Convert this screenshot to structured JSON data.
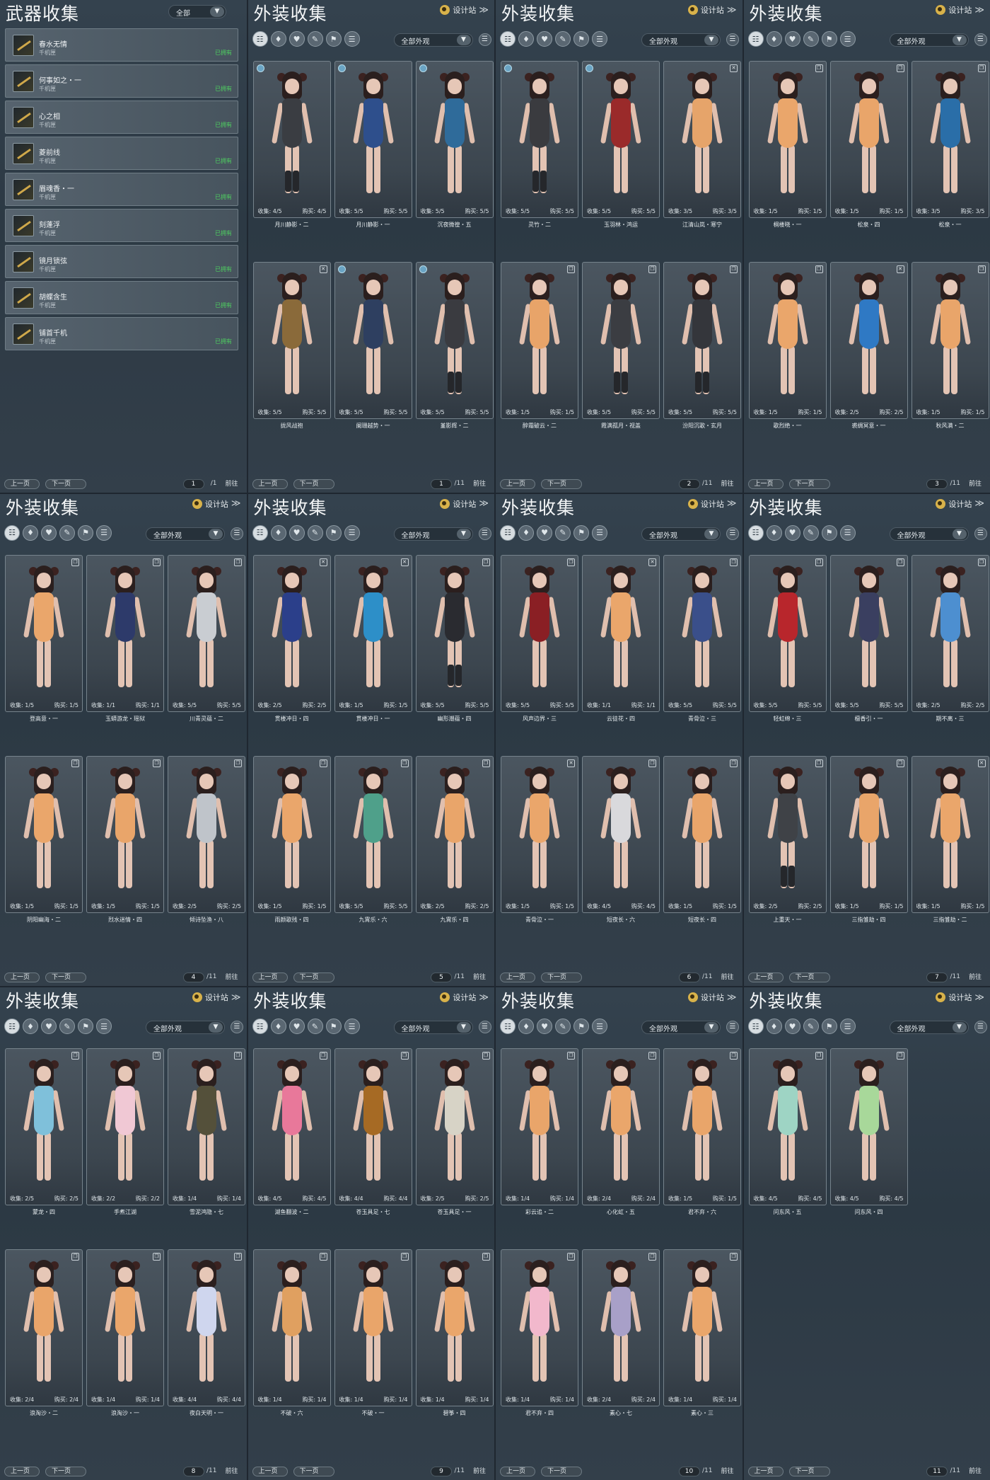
{
  "weapon_panel": {
    "title": "武器收集",
    "filter_value": "全部",
    "items": [
      {
        "name": "春水无情",
        "sub": "千机匣",
        "status": "已拥有"
      },
      {
        "name": "何事如之・一",
        "sub": "千机匣",
        "status": "已拥有"
      },
      {
        "name": "心之相",
        "sub": "千机匣",
        "status": "已拥有"
      },
      {
        "name": "菱前线",
        "sub": "千机匣",
        "status": "已拥有"
      },
      {
        "name": "眉魂香・一",
        "sub": "千机匣",
        "status": "已拥有"
      },
      {
        "name": "刻蓬浮",
        "sub": "千机匣",
        "status": "已拥有"
      },
      {
        "name": "镜月锁弦",
        "sub": "千机匣",
        "status": "已拥有"
      },
      {
        "name": "胡蝶含生",
        "sub": "千机匣",
        "status": "已拥有"
      },
      {
        "name": "铺首千机",
        "sub": "千机匣",
        "status": "已拥有"
      }
    ],
    "pager": {
      "prev": "上一页",
      "next": "下一页",
      "page": "1",
      "total": "/1",
      "go": "前往"
    }
  },
  "common": {
    "title": "外装收集",
    "design_label": "设计站",
    "chevron": "≫",
    "filter_value": "全部外观",
    "collect_label": "收集:",
    "buy_label": "购买:",
    "prev": "上一页",
    "next": "下一页",
    "go": "前往"
  },
  "outfit_panels": [
    {
      "page": "1",
      "total": "/11",
      "cards": [
        {
          "name": "月川静影・二",
          "collect": "4/5",
          "buy": "4/5",
          "tone": "#3a3d42",
          "badge": "blue"
        },
        {
          "name": "月川静影・一",
          "collect": "5/5",
          "buy": "5/5",
          "tone": "#2e4f8c",
          "badge": "blue"
        },
        {
          "name": "沉夜微徨・五",
          "collect": "5/5",
          "buy": "5/5",
          "tone": "#2f6b9a",
          "badge": "blue"
        },
        {
          "name": "拢风战袍",
          "collect": "5/5",
          "buy": "5/5",
          "tone": "#8a6a3a",
          "badge": "trash"
        },
        {
          "name": "阑珊越势・一",
          "collect": "5/5",
          "buy": "5/5",
          "tone": "#2e3f60",
          "badge": "blue"
        },
        {
          "name": "堇影辉・二",
          "collect": "5/5",
          "buy": "5/5",
          "tone": "#3a3b40",
          "badge": "blue"
        }
      ]
    },
    {
      "page": "2",
      "total": "/11",
      "cards": [
        {
          "name": "灵竹・二",
          "collect": "5/5",
          "buy": "5/5",
          "tone": "#3a3b3f",
          "badge": "blue"
        },
        {
          "name": "玉羽林・鸿运",
          "collect": "5/5",
          "buy": "5/5",
          "tone": "#9a2a2a",
          "badge": "blue"
        },
        {
          "name": "江清山岚・寒宁",
          "collect": "3/5",
          "buy": "3/5",
          "tone": "#e6a46a",
          "badge": "trash"
        },
        {
          "name": "醉霜破云・二",
          "collect": "1/5",
          "buy": "1/5",
          "tone": "#e8a469",
          "badge": "copy"
        },
        {
          "name": "霞满孤月・视盖",
          "collect": "5/5",
          "buy": "5/5",
          "tone": "#3b3d42",
          "badge": "copy"
        },
        {
          "name": "汾阳沉歌・玄月",
          "collect": "5/5",
          "buy": "5/5",
          "tone": "#34363b",
          "badge": "copy"
        }
      ]
    },
    {
      "page": "3",
      "total": "/11",
      "cards": [
        {
          "name": "桐楼晓・一",
          "collect": "1/5",
          "buy": "1/5",
          "tone": "#eaa66b",
          "badge": "copy"
        },
        {
          "name": "松泉・四",
          "collect": "1/5",
          "buy": "1/5",
          "tone": "#e9a56a",
          "badge": "copy"
        },
        {
          "name": "松泉・一",
          "collect": "3/5",
          "buy": "3/5",
          "tone": "#2a6ea8",
          "badge": "copy"
        },
        {
          "name": "歌烈绝・一",
          "collect": "1/5",
          "buy": "1/5",
          "tone": "#eaa66b",
          "badge": "copy"
        },
        {
          "name": "裘绸冥意・一",
          "collect": "2/5",
          "buy": "2/5",
          "tone": "#2f79c4",
          "badge": "trash"
        },
        {
          "name": "秋风满・二",
          "collect": "1/5",
          "buy": "1/5",
          "tone": "#e9a56a",
          "badge": "copy"
        }
      ]
    },
    {
      "page": "4",
      "total": "/11",
      "cards": [
        {
          "name": "登高意・一",
          "collect": "1/5",
          "buy": "1/5",
          "tone": "#eaa66b",
          "badge": "copy"
        },
        {
          "name": "玉蟒游龙・瑶狱",
          "collect": "1/1",
          "buy": "1/1",
          "tone": "#2d3a6a",
          "badge": "copy"
        },
        {
          "name": "川青灵蕴・二",
          "collect": "5/5",
          "buy": "5/5",
          "tone": "#c9cdd2",
          "badge": "copy"
        },
        {
          "name": "阴阳幽海・二",
          "collect": "1/5",
          "buy": "1/5",
          "tone": "#eaa66b",
          "badge": "copy"
        },
        {
          "name": "烈水迷情・四",
          "collect": "1/5",
          "buy": "1/5",
          "tone": "#e9a56a",
          "badge": "copy"
        },
        {
          "name": "倾诗坠渔・八",
          "collect": "2/5",
          "buy": "2/5",
          "tone": "#bfc4ca",
          "badge": "copy"
        }
      ]
    },
    {
      "page": "5",
      "total": "/11",
      "cards": [
        {
          "name": "贯楼冲日・四",
          "collect": "2/5",
          "buy": "2/5",
          "tone": "#2b3f8a",
          "badge": "trash"
        },
        {
          "name": "贯楼冲日・一",
          "collect": "1/5",
          "buy": "1/5",
          "tone": "#2d8fc8",
          "badge": "trash"
        },
        {
          "name": "幽形潮蕴・四",
          "collect": "5/5",
          "buy": "5/5",
          "tone": "#2a2b30",
          "badge": "copy"
        },
        {
          "name": "雨颜歌残・四",
          "collect": "1/5",
          "buy": "1/5",
          "tone": "#eaa66b",
          "badge": "copy"
        },
        {
          "name": "九霄乐・六",
          "collect": "5/5",
          "buy": "5/5",
          "tone": "#4fa08a",
          "badge": "copy"
        },
        {
          "name": "九霄乐・四",
          "collect": "2/5",
          "buy": "2/5",
          "tone": "#e9a56a",
          "badge": "copy"
        }
      ]
    },
    {
      "page": "6",
      "total": "/11",
      "cards": [
        {
          "name": "风声边界・三",
          "collect": "5/5",
          "buy": "5/5",
          "tone": "#8a1f24",
          "badge": "copy"
        },
        {
          "name": "云徒花・四",
          "collect": "1/1",
          "buy": "1/1",
          "tone": "#eaa66b",
          "badge": "trash"
        },
        {
          "name": "青骨泣・三",
          "collect": "5/5",
          "buy": "5/5",
          "tone": "#3a4f8a",
          "badge": "copy"
        },
        {
          "name": "青骨泣・一",
          "collect": "1/5",
          "buy": "1/5",
          "tone": "#eaa66b",
          "badge": "trash"
        },
        {
          "name": "短夜长・六",
          "collect": "4/5",
          "buy": "4/5",
          "tone": "#d9d9dc",
          "badge": "copy"
        },
        {
          "name": "短夜长・四",
          "collect": "1/5",
          "buy": "1/5",
          "tone": "#e9a56a",
          "badge": "copy"
        }
      ]
    },
    {
      "page": "7",
      "total": "/11",
      "cards": [
        {
          "name": "轻虹绵・三",
          "collect": "5/5",
          "buy": "5/5",
          "tone": "#b8262c",
          "badge": "copy"
        },
        {
          "name": "檀香引・一",
          "collect": "5/5",
          "buy": "5/5",
          "tone": "#3a3f60",
          "badge": "copy"
        },
        {
          "name": "期不离・三",
          "collect": "2/5",
          "buy": "2/5",
          "tone": "#4d8fd0",
          "badge": "copy"
        },
        {
          "name": "上重天・一",
          "collect": "2/5",
          "buy": "2/5",
          "tone": "#3f4247",
          "badge": "copy"
        },
        {
          "name": "三指雏劫・四",
          "collect": "1/5",
          "buy": "1/5",
          "tone": "#e9a56a",
          "badge": "copy"
        },
        {
          "name": "三指雏劫・二",
          "collect": "1/5",
          "buy": "1/5",
          "tone": "#eaa66b",
          "badge": "trash"
        }
      ]
    },
    {
      "page": "8",
      "total": "/11",
      "cards": [
        {
          "name": "蒙龙・四",
          "collect": "2/5",
          "buy": "2/5",
          "tone": "#7fc0da",
          "badge": "copy"
        },
        {
          "name": "手煮江湖",
          "collect": "2/2",
          "buy": "2/2",
          "tone": "#f0c8d4",
          "badge": "copy"
        },
        {
          "name": "雪泥鸿隐・七",
          "collect": "1/4",
          "buy": "1/4",
          "tone": "#54503a",
          "badge": "copy"
        },
        {
          "name": "浪淘沙・二",
          "collect": "2/4",
          "buy": "2/4",
          "tone": "#e9a56a",
          "badge": "copy"
        },
        {
          "name": "浪淘沙・一",
          "collect": "1/4",
          "buy": "1/4",
          "tone": "#eaa66b",
          "badge": "copy"
        },
        {
          "name": "夜白天明・一",
          "collect": "4/4",
          "buy": "4/4",
          "tone": "#cfd6ee",
          "badge": "copy"
        }
      ]
    },
    {
      "page": "9",
      "total": "/11",
      "cards": [
        {
          "name": "湖鱼翻波・二",
          "collect": "4/5",
          "buy": "4/5",
          "tone": "#e8789a",
          "badge": "copy"
        },
        {
          "name": "苍玉具足・七",
          "collect": "4/4",
          "buy": "4/4",
          "tone": "#a66a24",
          "badge": "copy"
        },
        {
          "name": "苍玉具足・一",
          "collect": "2/5",
          "buy": "2/5",
          "tone": "#d7d3c6",
          "badge": "copy"
        },
        {
          "name": "不破・六",
          "collect": "1/4",
          "buy": "1/4",
          "tone": "#e0a060",
          "badge": "copy"
        },
        {
          "name": "不破・一",
          "collect": "1/4",
          "buy": "1/4",
          "tone": "#e9a56a",
          "badge": "copy"
        },
        {
          "name": "碧筝・四",
          "collect": "1/4",
          "buy": "1/4",
          "tone": "#eaa66b",
          "badge": "copy"
        }
      ]
    },
    {
      "page": "10",
      "total": "/11",
      "cards": [
        {
          "name": "彩云追・二",
          "collect": "1/4",
          "buy": "1/4",
          "tone": "#e9a56a",
          "badge": "copy"
        },
        {
          "name": "心化虹・五",
          "collect": "2/4",
          "buy": "2/4",
          "tone": "#eaa66b",
          "badge": "copy"
        },
        {
          "name": "君不弃・六",
          "collect": "1/5",
          "buy": "1/5",
          "tone": "#e9a56a",
          "badge": "copy"
        },
        {
          "name": "君不弃・四",
          "collect": "1/4",
          "buy": "1/4",
          "tone": "#f2b8cc",
          "badge": "copy"
        },
        {
          "name": "素心・七",
          "collect": "2/4",
          "buy": "2/4",
          "tone": "#a8a0c8",
          "badge": "copy"
        },
        {
          "name": "素心・三",
          "collect": "1/4",
          "buy": "1/4",
          "tone": "#eaa66b",
          "badge": "copy"
        }
      ]
    },
    {
      "page": "11",
      "total": "/11",
      "cards": [
        {
          "name": "问东风・五",
          "collect": "4/5",
          "buy": "4/5",
          "tone": "#9ed4c4",
          "badge": "copy"
        },
        {
          "name": "问东风・四",
          "collect": "4/5",
          "buy": "4/5",
          "tone": "#a8d89a",
          "badge": "copy"
        }
      ]
    }
  ]
}
